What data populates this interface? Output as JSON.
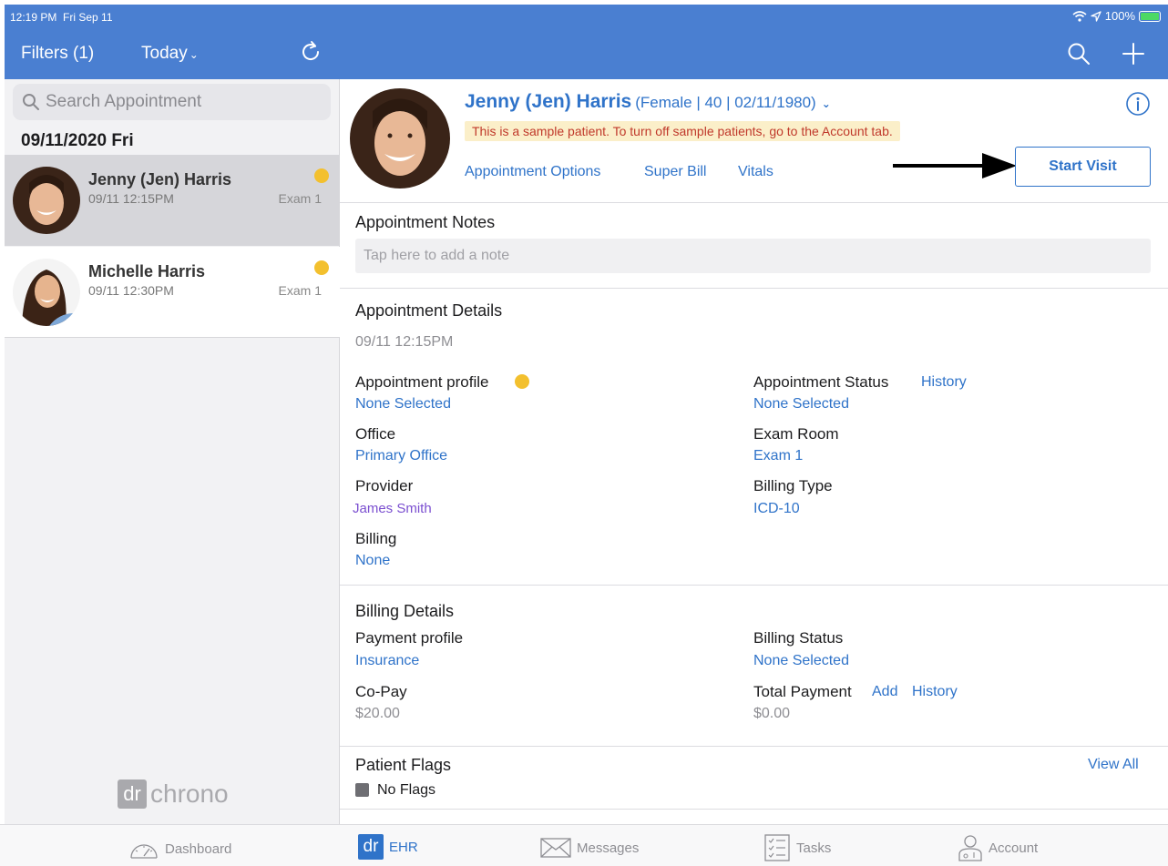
{
  "status_bar": {
    "time": "12:19 PM",
    "date": "Fri Sep 11",
    "battery": "100%"
  },
  "left_header": {
    "filters_label": "Filters (1)",
    "today_label": "Today",
    "today_chevron": "⌄"
  },
  "search": {
    "placeholder": "Search Appointment"
  },
  "appointments": {
    "date_header": "09/11/2020 Fri",
    "items": [
      {
        "name": "Jenny (Jen) Harris",
        "time": "09/11 12:15PM",
        "room": "Exam 1",
        "status_color": "#f3c02e"
      },
      {
        "name": "Michelle Harris",
        "time": "09/11 12:30PM",
        "room": "Exam 1",
        "status_color": "#f3c02e"
      }
    ]
  },
  "logo": {
    "mark": "dr",
    "text": "chrono"
  },
  "patient": {
    "name": "Jenny (Jen) Harris",
    "meta": "(Female | 40 | 02/11/1980)",
    "sample_notice": "This is a sample patient. To turn off sample patients, go to the Account tab.",
    "links": {
      "appointment_options": "Appointment Options",
      "super_bill": "Super Bill",
      "vitals": "Vitals"
    },
    "start_visit_label": "Start Visit"
  },
  "appointment_notes": {
    "title": "Appointment Notes",
    "placeholder": "Tap here to add a note"
  },
  "appointment_details": {
    "title": "Appointment Details",
    "datetime": "09/11 12:15PM",
    "profile_label": "Appointment profile",
    "profile_value": "None Selected",
    "status_label": "Appointment Status",
    "status_history": "History",
    "status_value": "None Selected",
    "office_label": "Office",
    "office_value": "Primary Office",
    "exam_room_label": "Exam Room",
    "exam_room_value": "Exam 1",
    "provider_label": "Provider",
    "provider_value": "James Smith",
    "billing_type_label": "Billing Type",
    "billing_type_value": "ICD-10",
    "billing_label": "Billing",
    "billing_value": "None"
  },
  "billing_details": {
    "title": "Billing Details",
    "payment_profile_label": "Payment profile",
    "payment_profile_value": "Insurance",
    "billing_status_label": "Billing Status",
    "billing_status_value": "None Selected",
    "copay_label": "Co-Pay",
    "copay_value": "$20.00",
    "total_payment_label": "Total Payment",
    "total_add": "Add",
    "total_history": "History",
    "total_payment_value": "$0.00"
  },
  "patient_flags": {
    "title": "Patient Flags",
    "view_all": "View All",
    "value": "No Flags"
  },
  "tabbar": {
    "dashboard": "Dashboard",
    "ehr_mark": "dr",
    "ehr": "EHR",
    "messages": "Messages",
    "tasks": "Tasks",
    "account": "Account"
  },
  "colors": {
    "header_blue": "#4a7fd1",
    "link_blue": "#2f73c9",
    "status_yellow": "#f3c02e",
    "provider_purple": "#7b4fd0"
  }
}
